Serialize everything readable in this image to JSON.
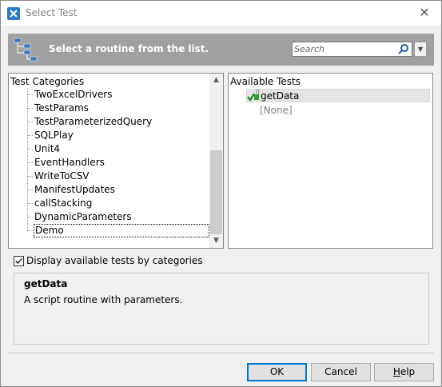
{
  "window": {
    "title": "Select Test",
    "close_glyph": "✕"
  },
  "banner": {
    "text": "Select a routine from the list.",
    "icon": "tree-hierarchy-icon"
  },
  "search": {
    "placeholder": "Search",
    "value": ""
  },
  "categories": {
    "header": "Test Categories",
    "items": [
      {
        "label": "TwoExcelDrivers"
      },
      {
        "label": "TestParams"
      },
      {
        "label": "TestParameterizedQuery"
      },
      {
        "label": "SQLPlay"
      },
      {
        "label": "Unit4"
      },
      {
        "label": "EventHandlers"
      },
      {
        "label": "WriteToCSV"
      },
      {
        "label": "ManifestUpdates"
      },
      {
        "label": "callStacking"
      },
      {
        "label": "DynamicParameters"
      },
      {
        "label": "Demo",
        "selected": true
      }
    ]
  },
  "tests": {
    "header": "Available Tests",
    "items": [
      {
        "label": "getData",
        "selected": true,
        "icon": "routine-with-params-icon"
      },
      {
        "label": "[None]"
      }
    ]
  },
  "options": {
    "display_by_categories_label": "Display available tests by categories",
    "display_by_categories_checked": true
  },
  "description": {
    "title": "getData",
    "text": "A script routine with parameters."
  },
  "buttons": {
    "ok": "OK",
    "cancel": "Cancel",
    "help_prefix": "",
    "help_mnemonic": "H",
    "help_suffix": "elp"
  },
  "colors": {
    "banner": "#a0a0a0",
    "accent": "#0078d7",
    "selection": "#e5e5e5"
  }
}
